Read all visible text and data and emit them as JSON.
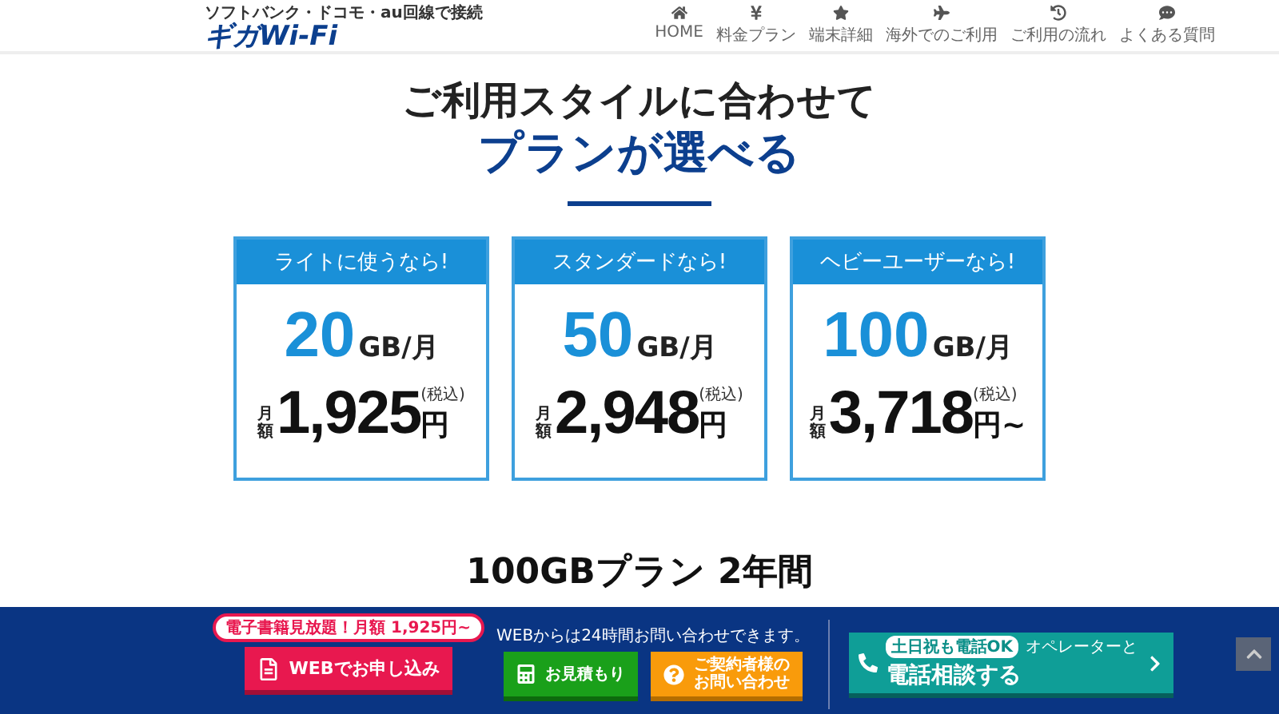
{
  "header": {
    "tagline": "ソフトバンク・ドコモ・au回線で接続",
    "logo": {
      "main": "ギガ",
      "accent": "Wi-Fi"
    },
    "nav": [
      {
        "label": "HOME"
      },
      {
        "label": "料金プラン"
      },
      {
        "label": "端末詳細"
      },
      {
        "label": "海外でのご利用"
      },
      {
        "label": "ご利用の流れ"
      },
      {
        "label": "よくある質問"
      }
    ]
  },
  "hero": {
    "title_line1": "ご利用スタイルに合わせて",
    "title_line2": "プランが選べる"
  },
  "plans": [
    {
      "label": "ライトに使うなら!",
      "amount": "20",
      "unit": "GB/月",
      "price_prefix": "月額",
      "price": "1,925",
      "currency": "円",
      "tax_note": "(税込)"
    },
    {
      "label": "スタンダードなら!",
      "amount": "50",
      "unit": "GB/月",
      "price_prefix": "月額",
      "price": "2,948",
      "currency": "円",
      "tax_note": "(税込)"
    },
    {
      "label": "ヘビーユーザーなら!",
      "amount": "100",
      "unit": "GB/月",
      "price_prefix": "月額",
      "price": "3,718",
      "currency": "円~",
      "tax_note": "(税込)"
    }
  ],
  "section2": {
    "title": "100GBプラン 2年間"
  },
  "footer_bar": {
    "promo_badge": "電子書籍見放題！月額 1,925円~",
    "web_button": "WEBでお申し込み",
    "web_note": "WEBからは24時間お問い合わせできます。",
    "estimate_button": "お見積もり",
    "contact_button": [
      "ご契約者様の",
      "お問い合わせ"
    ],
    "phone_badge": "土日祝も電話OK",
    "phone_sub": "オペレーターと",
    "phone_main": "電話相談する"
  }
}
